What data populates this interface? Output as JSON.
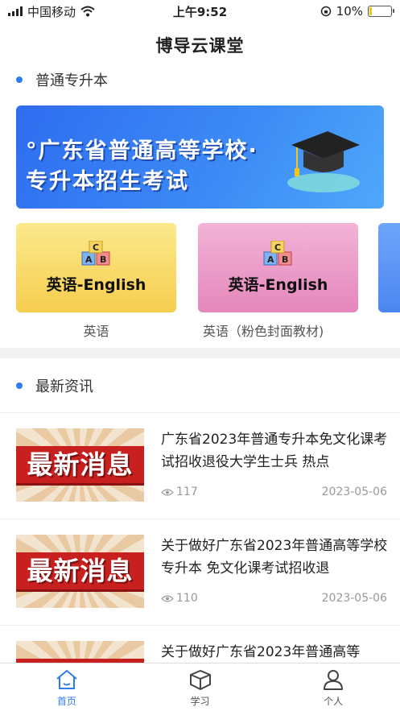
{
  "status_bar": {
    "carrier": "中国移动",
    "time": "上午9:52",
    "battery": "10%",
    "battery_level": 0.1
  },
  "header": {
    "title": "博导云课堂"
  },
  "section_regular": {
    "title": "普通专升本",
    "banner": {
      "line1": "°广东省普通高等学校·",
      "line2": "专升本招生考试"
    },
    "courses": [
      {
        "cover_title": "英语-English",
        "caption": "英语"
      },
      {
        "cover_title": "英语-English",
        "caption": "英语（粉色封面教材)"
      }
    ]
  },
  "section_news": {
    "title": "最新资讯",
    "thumb_text": "最新消息",
    "items": [
      {
        "title": "广东省2023年普通专升本免文化课考试招收退役大学生士兵 热点",
        "views": "117",
        "date": "2023-05-06"
      },
      {
        "title": "关于做好广东省2023年普通高等学校专升本 免文化课考试招收退",
        "views": "110",
        "date": "2023-05-06"
      },
      {
        "title": "关于做好广东省2023年普通高等",
        "views": "",
        "date": ""
      }
    ]
  },
  "tabbar": {
    "items": [
      {
        "label": "首页",
        "icon": "home-icon",
        "active": true
      },
      {
        "label": "学习",
        "icon": "cube-book-icon",
        "active": false
      },
      {
        "label": "个人",
        "icon": "person-icon",
        "active": false
      }
    ]
  },
  "colors": {
    "accent": "#2f7bf2",
    "news_red": "#c8201f"
  }
}
